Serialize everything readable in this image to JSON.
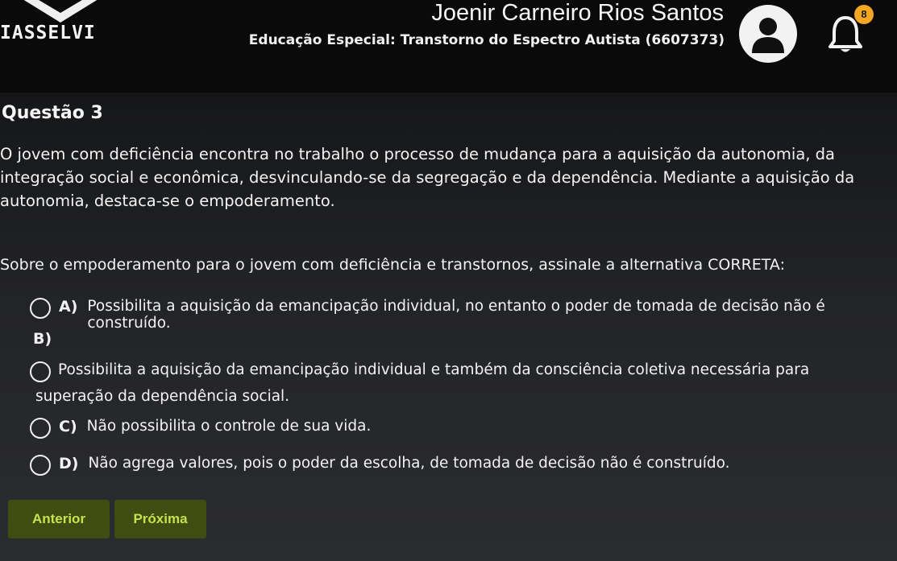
{
  "header": {
    "brand": "IASSELVI",
    "user_name": "Joenir Carneiro Rios Santos",
    "course": "Educação Especial: Transtorno do Espectro Autista (6607373)",
    "notification_count": "8"
  },
  "question": {
    "title": "Questão 3",
    "statement": "O jovem com deficiência encontra no trabalho o processo de mudança para a aquisição da autonomia, da integração social e econômica, desvinculando-se da segregação e da dependência. Mediante a aquisição da autonomia, destaca-se o empoderamento.",
    "prompt": "Sobre o empoderamento para o jovem com deficiência e transtornos, assinale a alternativa CORRETA:",
    "options": [
      {
        "letter": "A)",
        "text": "Possibilita a aquisição da emancipação individual, no entanto o poder de tomada de decisão não é construído."
      },
      {
        "letter": "B)",
        "text": "Possibilita a aquisição da emancipação individual e também da consciência coletiva necessária para superação da dependência social."
      },
      {
        "letter": "C)",
        "text": "Não possibilita o controle de sua vida."
      },
      {
        "letter": "D)",
        "text": "Não agrega valores, pois o poder da escolha, de tomada de decisão não é construído."
      }
    ]
  },
  "nav": {
    "prev_label": "Anterior",
    "next_label": "Próxima"
  },
  "colors": {
    "button_bg": "#3f4d12",
    "button_text": "#c7e24e",
    "badge": "#f5a623"
  },
  "icons": {
    "avatar": "user-avatar-icon",
    "bell": "bell-icon",
    "logo": "logo-icon"
  }
}
